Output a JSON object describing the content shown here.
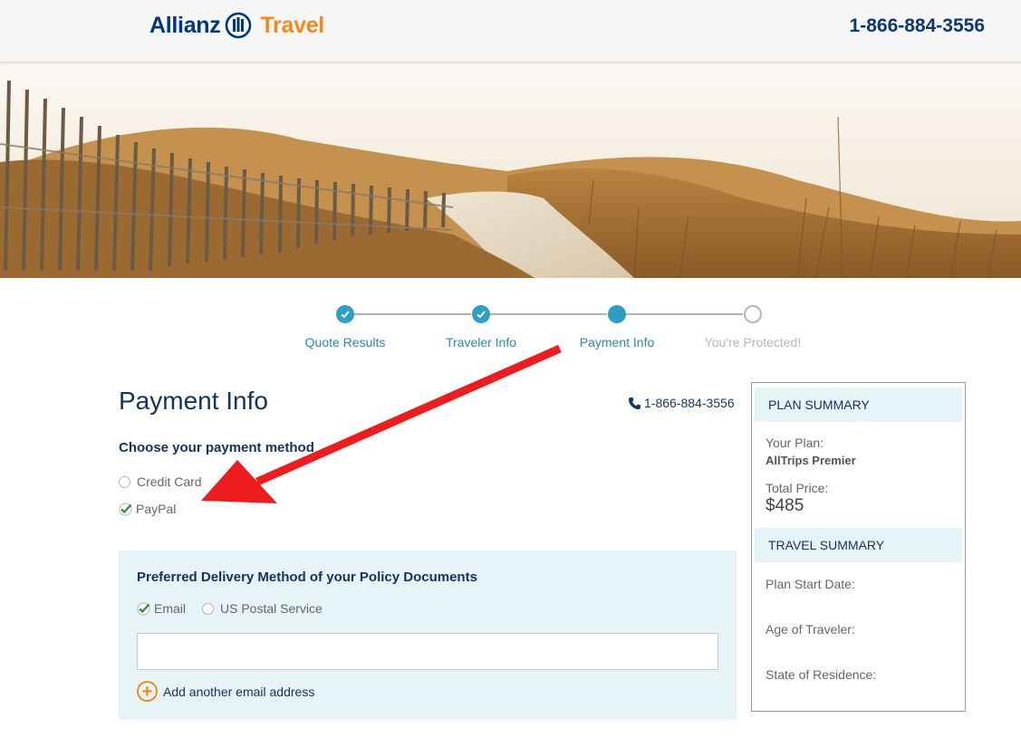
{
  "header": {
    "logo_word1": "Allianz",
    "logo_word2": "Travel",
    "phone": "1-866-884-3556"
  },
  "stepper": {
    "steps": [
      {
        "label": "Quote Results",
        "state": "done"
      },
      {
        "label": "Traveler Info",
        "state": "done"
      },
      {
        "label": "Payment Info",
        "state": "active"
      },
      {
        "label": "You're Protected!",
        "state": "todo"
      }
    ]
  },
  "main": {
    "title": "Payment Info",
    "phone": "1-866-884-3556",
    "payment_method_label": "Choose your payment method",
    "payment_options": [
      {
        "label": "Credit Card",
        "selected": false
      },
      {
        "label": "PayPal",
        "selected": true
      }
    ],
    "delivery": {
      "title": "Preferred Delivery Method of your Policy Documents",
      "options": [
        {
          "label": "Email",
          "selected": true
        },
        {
          "label": "US Postal Service",
          "selected": false
        }
      ],
      "email_value": "",
      "add_email_label": "Add another email address"
    }
  },
  "sidebar": {
    "plan_header": "PLAN SUMMARY",
    "your_plan_label": "Your Plan:",
    "your_plan_value": "AllTrips Premier",
    "total_price_label": "Total Price:",
    "total_price_value": "$485",
    "travel_header": "TRAVEL SUMMARY",
    "start_date_label": "Plan Start Date:",
    "age_label": "Age of Traveler:",
    "state_label": "State of Residence:"
  },
  "colors": {
    "brand_blue": "#003781",
    "brand_orange": "#f28a1e",
    "step_blue": "#2d9fc4",
    "panel_bg": "#e6f3f7",
    "annotation_red": "#ee1c1c"
  }
}
